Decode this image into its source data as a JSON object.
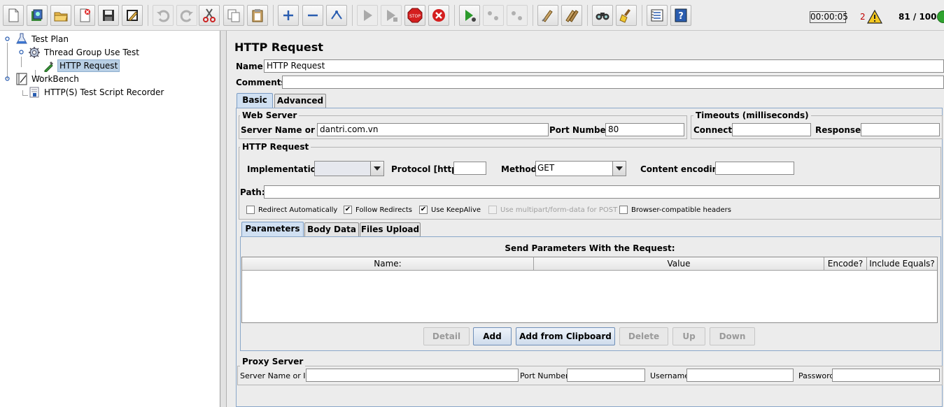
{
  "toolbar": {
    "timer": "00:00:05",
    "error_count": "2",
    "threads": "81 / 100",
    "buttons": [
      {
        "icon": "new-icon",
        "enabled": true
      },
      {
        "icon": "templates-icon",
        "enabled": true
      },
      {
        "icon": "open-icon",
        "enabled": true
      },
      {
        "icon": "close-icon",
        "enabled": true
      },
      {
        "icon": "save-icon",
        "enabled": true
      },
      {
        "icon": "save-as-icon",
        "enabled": true
      },
      {
        "icon": "undo-icon",
        "enabled": false
      },
      {
        "icon": "redo-icon",
        "enabled": false
      },
      {
        "icon": "cut-icon",
        "enabled": true
      },
      {
        "icon": "copy-icon",
        "enabled": true
      },
      {
        "icon": "paste-icon",
        "enabled": true
      },
      {
        "icon": "expand-icon",
        "enabled": true
      },
      {
        "icon": "collapse-icon",
        "enabled": true
      },
      {
        "icon": "toggle-icon",
        "enabled": true
      },
      {
        "icon": "start-icon",
        "enabled": false
      },
      {
        "icon": "start-no-pause-icon",
        "enabled": false
      },
      {
        "icon": "stop-icon",
        "enabled": true
      },
      {
        "icon": "shutdown-icon",
        "enabled": true
      },
      {
        "icon": "remote-start-icon",
        "enabled": true
      },
      {
        "icon": "remote-stop-icon",
        "enabled": false
      },
      {
        "icon": "remote-shutdown-icon",
        "enabled": false
      },
      {
        "icon": "clear-icon",
        "enabled": true
      },
      {
        "icon": "clear-all-icon",
        "enabled": true
      },
      {
        "icon": "search-icon",
        "enabled": true
      },
      {
        "icon": "reset-search-icon",
        "enabled": true
      },
      {
        "icon": "function-helper-icon",
        "enabled": true
      },
      {
        "icon": "help-icon",
        "enabled": true
      }
    ]
  },
  "tree": {
    "nodes": [
      {
        "label": "Test Plan",
        "icon": "flask-icon"
      },
      {
        "label": "Thread Group Use Test",
        "icon": "gear-icon"
      },
      {
        "label": "HTTP Request",
        "icon": "pipette-icon",
        "selected": true
      },
      {
        "label": "WorkBench",
        "icon": "notebook-icon"
      },
      {
        "label": "HTTP(S) Test Script Recorder",
        "icon": "recorder-icon"
      }
    ]
  },
  "main": {
    "title": "HTTP Request",
    "name_label": "Name:",
    "name_value": "HTTP Request",
    "comments_label": "Comments:",
    "comments_value": "",
    "tabs": [
      "Basic",
      "Advanced"
    ],
    "web_server": {
      "title": "Web Server",
      "server_label": "Server Name or IP:",
      "server_value": "dantri.com.vn",
      "port_label": "Port Number:",
      "port_value": "80"
    },
    "timeouts": {
      "title": "Timeouts (milliseconds)",
      "connect_label": "Connect:",
      "connect_value": "",
      "response_label": "Response:",
      "response_value": ""
    },
    "http_request": {
      "title": "HTTP Request",
      "implementation_label": "Implementation:",
      "implementation_value": "",
      "protocol_label": "Protocol [http]:",
      "protocol_value": "",
      "method_label": "Method:",
      "method_value": "GET",
      "encoding_label": "Content encoding:",
      "encoding_value": "",
      "path_label": "Path:",
      "path_value": ""
    },
    "checkboxes": [
      {
        "label": "Redirect Automatically",
        "checked": false,
        "enabled": true
      },
      {
        "label": "Follow Redirects",
        "checked": true,
        "enabled": true
      },
      {
        "label": "Use KeepAlive",
        "checked": true,
        "enabled": true
      },
      {
        "label": "Use multipart/form-data for POST",
        "checked": false,
        "enabled": false
      },
      {
        "label": "Browser-compatible headers",
        "checked": false,
        "enabled": true
      }
    ],
    "sub_tabs": [
      "Parameters",
      "Body Data",
      "Files Upload"
    ],
    "params": {
      "caption": "Send Parameters With the Request:",
      "columns": [
        "Name:",
        "Value",
        "Encode?",
        "Include Equals?"
      ]
    },
    "buttons": {
      "detail": "Detail",
      "add": "Add",
      "add_clipboard": "Add from Clipboard",
      "delete": "Delete",
      "up": "Up",
      "down": "Down"
    },
    "proxy": {
      "title": "Proxy Server",
      "server_label": "Server Name or IP:",
      "server_value": "",
      "port_label": "Port Number:",
      "port_value": "",
      "username_label": "Username",
      "username_value": "",
      "password_label": "Password",
      "password_value": ""
    }
  }
}
